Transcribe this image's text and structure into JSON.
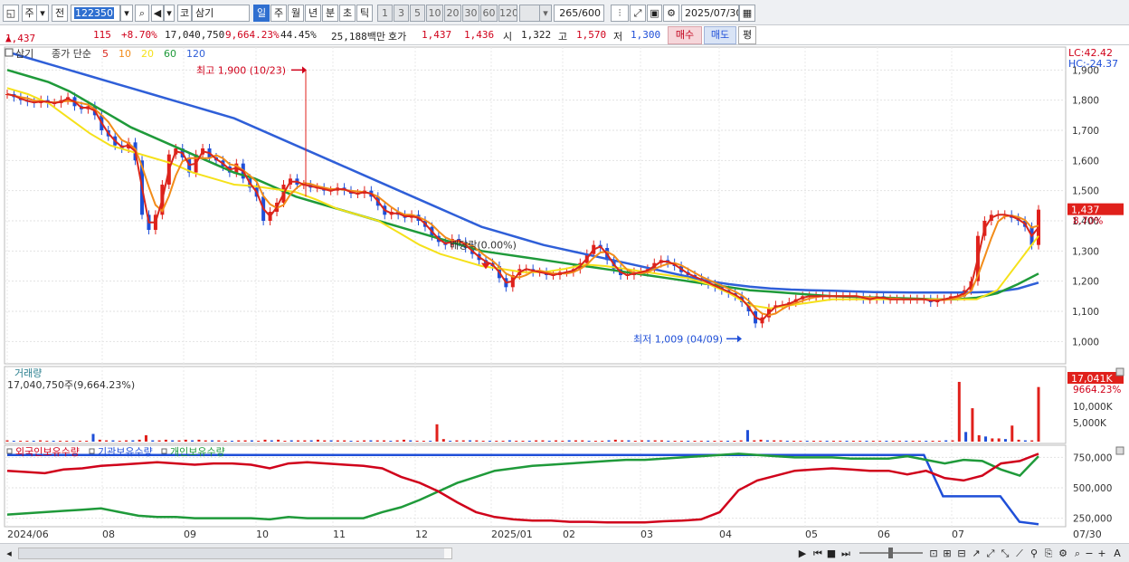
{
  "toolbar": {
    "type_label": "주",
    "prev_label": "전",
    "code_value": "122350",
    "market_tag": "코",
    "stock_name": "삼기",
    "periods": [
      "일",
      "주",
      "월",
      "년",
      "분",
      "초",
      "틱"
    ],
    "active_period": "일",
    "intervals": [
      "1",
      "3",
      "5",
      "10",
      "20",
      "30",
      "60",
      "120"
    ],
    "count_value": "265",
    "count_total": "/600",
    "date_value": "2025/07/30"
  },
  "quote": {
    "price": "1,437",
    "change_arrow": "▲",
    "change": "115",
    "change_pct": "+8.70%",
    "volume": "17,040,750",
    "volume_ratio": "9,664.23%",
    "turnover_pct": "44.45%",
    "amount": "25,188백만",
    "hoga_label": "호가",
    "ask": "1,437",
    "bid": "1,436",
    "open_label": "시",
    "open": "1,322",
    "high_label": "고",
    "high": "1,570",
    "low_label": "저",
    "low": "1,300",
    "buy_label": "매수",
    "sell_label": "매도",
    "eval_label": "평"
  },
  "price_panel": {
    "tab": "삼기",
    "legend_prefix": "종가 단순",
    "ma_labels": [
      "5",
      "10",
      "20",
      "60",
      "120"
    ],
    "ma_colors": [
      "#d9261c",
      "#f28c1a",
      "#f5e11a",
      "#1f9a3a",
      "#2f5fd8"
    ],
    "lc": "LC:42.42",
    "hc": "HC:-24.37",
    "current_price_tag": "1,437",
    "current_pct_tag": "8.70%",
    "high_annotation": "최고 1,900 (10/23)",
    "low_annotation": "최저 1,009 (04/09)",
    "dividend_annotation": "배당락(0.00%)",
    "y_ticks": [
      "1,900",
      "1,800",
      "1,700",
      "1,600",
      "1,500",
      "1,400",
      "1,300",
      "1,200",
      "1,100",
      "1,000"
    ]
  },
  "volume_panel": {
    "title": "거래량",
    "value_text": "17,040,750주(9,664.23%)",
    "tag_value": "17,041K",
    "tag_pct": "9664.23%",
    "y_ticks": [
      "10,000K",
      "5,000K"
    ]
  },
  "holding_panel": {
    "legends": [
      "외국인보유수량",
      "기관보유수량",
      "개인보유수량"
    ],
    "legend_colors": [
      "#d0021b",
      "#1f4fd8",
      "#1f9a3a"
    ],
    "y_ticks": [
      "750,000",
      "500,000",
      "250,000"
    ]
  },
  "x_axis": {
    "labels": [
      "2024/06",
      "08",
      "09",
      "10",
      "11",
      "12",
      "2025/01",
      "02",
      "03",
      "04",
      "05",
      "06",
      "07"
    ],
    "right_label": "07/30"
  },
  "chart_data": {
    "type": "line",
    "title": "",
    "y_range": [
      980,
      1940
    ],
    "x_range": [
      0,
      290
    ],
    "candles_close": [
      1820,
      1810,
      1800,
      1795,
      1790,
      1800,
      1790,
      1790,
      1800,
      1810,
      1780,
      1770,
      1780,
      1750,
      1700,
      1680,
      1650,
      1640,
      1660,
      1600,
      1420,
      1370,
      1420,
      1520,
      1620,
      1640,
      1610,
      1560,
      1620,
      1640,
      1610,
      1600,
      1580,
      1560,
      1590,
      1540,
      1510,
      1480,
      1400,
      1430,
      1460,
      1520,
      1540,
      1520,
      1520,
      1510,
      1510,
      1500,
      1500,
      1510,
      1500,
      1490,
      1490,
      1500,
      1480,
      1450,
      1420,
      1430,
      1420,
      1410,
      1420,
      1400,
      1380,
      1350,
      1330,
      1320,
      1340,
      1330,
      1310,
      1290,
      1270,
      1260,
      1250,
      1210,
      1180,
      1220,
      1240,
      1240,
      1230,
      1230,
      1220,
      1220,
      1230,
      1230,
      1240,
      1260,
      1290,
      1320,
      1310,
      1270,
      1240,
      1220,
      1220,
      1230,
      1230,
      1240,
      1260,
      1270,
      1260,
      1250,
      1230,
      1220,
      1210,
      1200,
      1190,
      1180,
      1170,
      1160,
      1150,
      1130,
      1100,
      1060,
      1080,
      1110,
      1120,
      1120,
      1130,
      1140,
      1150,
      1150,
      1150,
      1150,
      1150,
      1150,
      1150,
      1150,
      1150,
      1140,
      1140,
      1150,
      1140,
      1140,
      1140,
      1140,
      1140,
      1140,
      1140,
      1130,
      1140,
      1140,
      1150,
      1150,
      1170,
      1200,
      1350,
      1400,
      1420,
      1420,
      1420,
      1410,
      1400,
      1380,
      1320,
      1437
    ],
    "series": [
      {
        "name": "5",
        "color": "#d9261c"
      },
      {
        "name": "10",
        "color": "#f28c1a"
      },
      {
        "name": "20",
        "color": "#f5e11a"
      },
      {
        "name": "60",
        "color": "#1f9a3a"
      },
      {
        "name": "120",
        "color": "#2f5fd8"
      }
    ],
    "ma60": [
      1900,
      1880,
      1860,
      1830,
      1790,
      1750,
      1710,
      1680,
      1650,
      1620,
      1590,
      1560,
      1540,
      1510,
      1480,
      1460,
      1440,
      1420,
      1400,
      1380,
      1360,
      1340,
      1320,
      1300,
      1290,
      1280,
      1270,
      1260,
      1250,
      1240,
      1230,
      1220,
      1210,
      1200,
      1190,
      1180,
      1170,
      1165,
      1160,
      1155,
      1150,
      1148,
      1146,
      1144,
      1142,
      1140,
      1140,
      1145,
      1160,
      1190,
      1225
    ],
    "ma120": [
      1960,
      1940,
      1920,
      1900,
      1880,
      1860,
      1840,
      1820,
      1800,
      1780,
      1760,
      1740,
      1710,
      1680,
      1650,
      1620,
      1590,
      1560,
      1530,
      1500,
      1470,
      1440,
      1410,
      1380,
      1360,
      1340,
      1320,
      1305,
      1290,
      1275,
      1260,
      1245,
      1230,
      1215,
      1200,
      1190,
      1182,
      1176,
      1172,
      1170,
      1168,
      1166,
      1164,
      1163,
      1162,
      1162,
      1162,
      1163,
      1165,
      1175,
      1195
    ],
    "ma20": [
      1840,
      1820,
      1790,
      1740,
      1690,
      1650,
      1630,
      1610,
      1590,
      1560,
      1540,
      1520,
      1515,
      1505,
      1495,
      1470,
      1440,
      1420,
      1400,
      1360,
      1320,
      1290,
      1270,
      1250,
      1240,
      1230,
      1230,
      1240,
      1255,
      1250,
      1240,
      1230,
      1220,
      1210,
      1190,
      1160,
      1120,
      1110,
      1120,
      1130,
      1140,
      1140,
      1140,
      1140,
      1140,
      1140,
      1140,
      1140,
      1170,
      1260,
      1350
    ],
    "volume": [
      0.02,
      0.01,
      0.01,
      0.01,
      0.01,
      0.02,
      0.01,
      0.01,
      0.01,
      0.01,
      0.01,
      0.01,
      0.01,
      0.12,
      0.03,
      0.02,
      0.02,
      0.01,
      0.02,
      0.02,
      0.03,
      0.1,
      0.02,
      0.02,
      0.03,
      0.02,
      0.02,
      0.03,
      0.02,
      0.03,
      0.02,
      0.02,
      0.02,
      0.01,
      0.01,
      0.02,
      0.02,
      0.02,
      0.01,
      0.03,
      0.02,
      0.03,
      0.01,
      0.02,
      0.02,
      0.02,
      0.02,
      0.03,
      0.02,
      0.02,
      0.02,
      0.02,
      0.01,
      0.01,
      0.02,
      0.02,
      0.02,
      0.02,
      0.01,
      0.02,
      0.03,
      0.02,
      0.01,
      0.01,
      0.01,
      0.27,
      0.04,
      0.01,
      0.02,
      0.02,
      0.02,
      0.02,
      0.01,
      0.01,
      0.01,
      0.01,
      0.02,
      0.01,
      0.01,
      0.01,
      0.02,
      0.02,
      0.01,
      0.02,
      0.01,
      0.02,
      0.02,
      0.02,
      0.01,
      0.01,
      0.01,
      0.02,
      0.03,
      0.02,
      0.02,
      0.01,
      0.02,
      0.02,
      0.02,
      0.02,
      0.01,
      0.01,
      0.01,
      0.01,
      0.01,
      0.01,
      0.01,
      0.01,
      0.01,
      0.01,
      0.01,
      0.02,
      0.18,
      0.02,
      0.03,
      0.02,
      0.02,
      0.02,
      0.01,
      0.01,
      0.01,
      0.01,
      0.01,
      0.01,
      0.01,
      0.01,
      0.01,
      0.01,
      0.01,
      0.01,
      0.01,
      0.01,
      0.01,
      0.01,
      0.01,
      0.01,
      0.01,
      0.01,
      0.01,
      0.01,
      0.01,
      0.01,
      0.02,
      0.02,
      0.93,
      0.15,
      0.52,
      0.1,
      0.08,
      0.05,
      0.05,
      0.04,
      0.25,
      0.03,
      0.02,
      0.02,
      0.85
    ],
    "foreign": [
      640,
      630,
      620,
      650,
      660,
      680,
      690,
      700,
      710,
      700,
      690,
      700,
      700,
      690,
      660,
      700,
      710,
      700,
      690,
      680,
      660,
      590,
      540,
      470,
      380,
      300,
      260,
      240,
      230,
      230,
      220,
      220,
      215,
      215,
      215,
      225,
      230,
      240,
      300,
      480,
      560,
      600,
      640,
      650,
      660,
      650,
      640,
      640,
      610,
      640,
      580,
      560,
      600,
      700,
      720,
      780
    ],
    "institution": [
      770,
      770,
      770,
      770,
      770,
      770,
      770,
      770,
      770,
      770,
      770,
      770,
      770,
      770,
      770,
      770,
      770,
      770,
      770,
      770,
      770,
      770,
      770,
      770,
      770,
      770,
      770,
      770,
      770,
      770,
      770,
      770,
      770,
      770,
      770,
      770,
      770,
      770,
      770,
      770,
      770,
      770,
      770,
      770,
      770,
      770,
      770,
      770,
      770,
      430,
      430,
      430,
      430,
      220,
      200
    ],
    "individual": [
      280,
      290,
      300,
      310,
      320,
      330,
      300,
      270,
      260,
      260,
      250,
      250,
      250,
      250,
      240,
      260,
      250,
      250,
      250,
      250,
      300,
      340,
      400,
      470,
      540,
      590,
      640,
      660,
      680,
      690,
      700,
      710,
      720,
      730,
      730,
      740,
      750,
      760,
      770,
      780,
      770,
      760,
      750,
      750,
      750,
      740,
      740,
      740,
      760,
      730,
      700,
      730,
      720,
      650,
      600,
      760
    ]
  },
  "bottom": {
    "nav_labels": [
      "▶",
      "⏮",
      "■",
      "⏭"
    ]
  }
}
